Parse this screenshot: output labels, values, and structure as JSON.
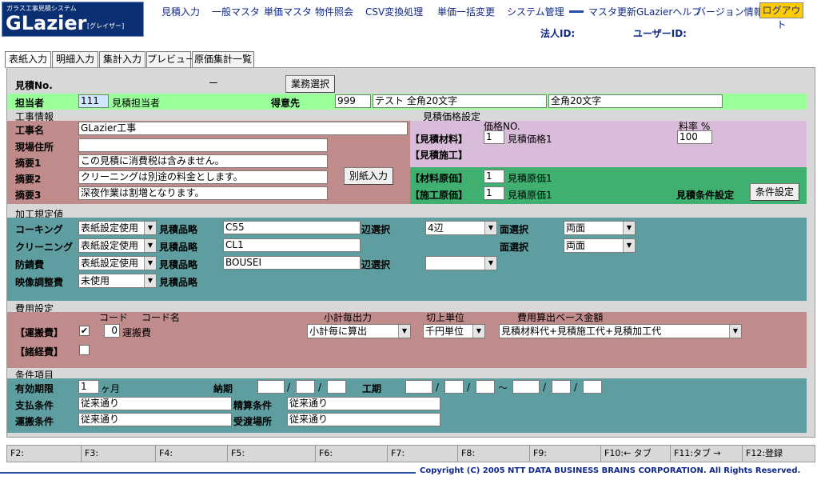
{
  "header": {
    "logo_sub": "ガラス工事見積システム",
    "logo_main": "GLazier",
    "logo_kana": "[グレイザー]",
    "nav": [
      "見積入力",
      "一般マスタ",
      "単価マスタ",
      "物件照会",
      "CSV変換処理",
      "単価一括変更",
      "システム管理"
    ],
    "nav2": [
      "マスタ更新",
      "GLazierヘルプ",
      "バージョン情報"
    ],
    "logout": "ログアウト",
    "corp_id_label": "法人ID:",
    "user_id_label": "ユーザーID:"
  },
  "tabs": [
    "表紙入力",
    "明細入力",
    "集計入力",
    "プレビュー",
    "原価集計一覧"
  ],
  "estimate": {
    "no_label": "見積No.",
    "no_dash": "ー",
    "job_select_button": "業務選択",
    "person_label": "担当者",
    "person_code": "111",
    "person_name": "見積担当者",
    "client_label": "得意先",
    "client_code": "999",
    "client_name1": "テスト 全角20文字",
    "client_name2": "全角20文字",
    "client_name3": "全角20文字"
  },
  "construction": {
    "section_title": "工事情報",
    "name_label": "工事名",
    "name_value": "GLazier工事",
    "site_label": "現場住所",
    "site_value": "",
    "note1_label": "摘要1",
    "note1_value": "この見積に消費税は含みません。",
    "note2_label": "摘要2",
    "note2_value": "クリーニングは別途の料金とします。",
    "note3_label": "摘要3",
    "note3_value": "深夜作業は割増となります。",
    "separate_button": "別紙入力"
  },
  "price_settings": {
    "section_title": "見積価格設定",
    "price_no_label": "価格NO.",
    "rate_label": "料率 %",
    "material_label": "【見積材料】",
    "material_no": "1",
    "material_name": "見積価格1",
    "material_rate": "100",
    "work_label": "【見積施工】",
    "cost_material_label": "【材料原価】",
    "cost_material_no": "1",
    "cost_material_name": "見積原価1",
    "cost_work_label": "【施工原価】",
    "cost_work_no": "1",
    "cost_work_name": "見積原価1",
    "condition_label": "見積条件設定",
    "condition_button": "条件設定"
  },
  "processing": {
    "section_title": "加工規定値",
    "rows": [
      {
        "label": "コーキング",
        "select": "表紙設定使用",
        "item_label": "見積品略",
        "item_value": "C55",
        "side_label": "辺選択",
        "side_value": "4辺",
        "face_label": "面選択",
        "face_value": "両面"
      },
      {
        "label": "クリーニング",
        "select": "表紙設定使用",
        "item_label": "見積品略",
        "item_value": "CL1",
        "side_label": "",
        "side_value": "",
        "face_label": "面選択",
        "face_value": "両面"
      },
      {
        "label": "防錆費",
        "select": "表紙設定使用",
        "item_label": "見積品略",
        "item_value": "BOUSEI",
        "side_label": "辺選択",
        "side_value": "",
        "face_label": "",
        "face_value": ""
      },
      {
        "label": "映像調整費",
        "select": "未使用",
        "item_label": "見積品略",
        "item_value": "",
        "side_label": "",
        "side_value": "",
        "face_label": "",
        "face_value": ""
      }
    ]
  },
  "costs": {
    "section_title": "費用設定",
    "code_label": "コード",
    "code_name_label": "コード名",
    "subtotal_label": "小計毎出力",
    "round_label": "切上単位",
    "base_label": "費用算出ベース金額",
    "transport_label": "【運搬費】",
    "transport_checked": "✔",
    "transport_code": "0",
    "transport_name": "運搬費",
    "transport_subtotal": "小計毎に算出",
    "transport_round": "千円単位",
    "transport_base": "見積材料代+見積施工代+見積加工代",
    "misc_label": "【諸経費】",
    "misc_checked": ""
  },
  "conditions": {
    "section_title": "条件項目",
    "validity_label": "有効期限",
    "validity_value": "1",
    "validity_unit": "ヶ月",
    "delivery_label": "納期",
    "period_label": "工期",
    "slash": "/",
    "tilde": "〜",
    "payment_label": "支払条件",
    "payment_value": "従来通り",
    "settlement_label": "精算条件",
    "settlement_value": "従来通り",
    "transport_label": "運搬条件",
    "transport_value": "従来通り",
    "handover_label": "受渡場所",
    "handover_value": "従来通り"
  },
  "function_keys": [
    "F2:",
    "F3:",
    "F4:",
    "F5:",
    "F6:",
    "F7:",
    "F8:",
    "F9:",
    "F10:← タブ",
    "F11:タブ →",
    "F12:登録"
  ],
  "footer": {
    "copyright": "Copyright (C) 2005 NTT DATA BUSINESS BRAINS CORPORATION. All Rights Reserved."
  },
  "colors": {
    "green_row": "#99ff99",
    "brown": "#c08b8b",
    "lavender": "#d9bcd9",
    "emerald": "#3fb070",
    "teal": "#5f9ea0",
    "nav_text": "#102a8a",
    "logout_bg": "#ffcc00"
  }
}
